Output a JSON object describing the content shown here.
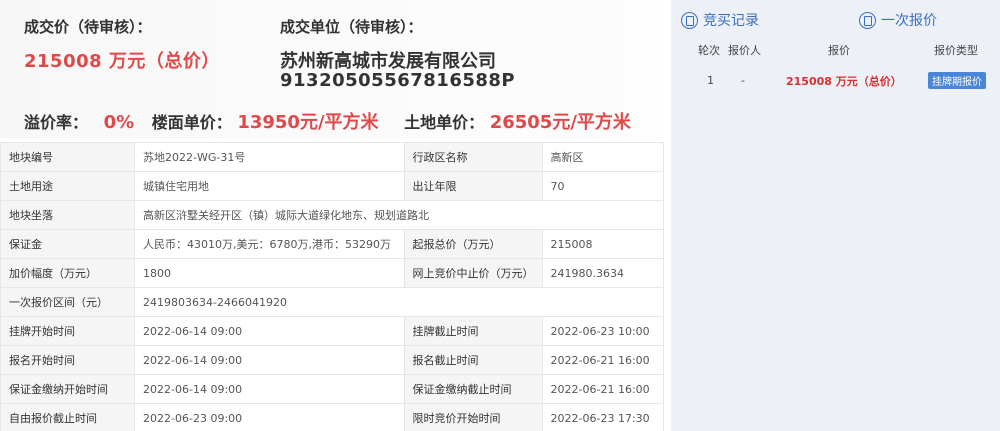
{
  "summary": {
    "deal_price_label": "成交价（待审核）：",
    "deal_price_value": "215008 万元（总价）",
    "deal_unit_label": "成交单位（待审核）：",
    "deal_unit_name": "苏州新高城市发展有限公司",
    "deal_unit_code": "91320505567816588P",
    "premium_label": "溢价率：",
    "premium_value": "0%",
    "floor_price_label": "楼面单价：",
    "floor_price_value": "13950元/平方米",
    "land_price_label": "土地单价：",
    "land_price_value": "26505元/平方米"
  },
  "info_table": {
    "rows": [
      {
        "k1": "地块编号",
        "v1": "苏地2022-WG-31号",
        "k2": "行政区名称",
        "v2": "高新区"
      },
      {
        "k1": "土地用途",
        "v1": "城镇住宅用地",
        "k2": "出让年限",
        "v2": "70"
      },
      {
        "k1": "地块坐落",
        "v1": "高新区浒墅关经开区（镇）城际大道绿化地东、规划道路北"
      },
      {
        "k1": "保证金",
        "v1": "人民币：43010万,美元：6780万,港币：53290万",
        "k2": "起报总价（万元）",
        "v2": "215008"
      },
      {
        "k1": "加价幅度（万元）",
        "v1": "1800",
        "k2": "网上竞价中止价（万元）",
        "v2": "241980.3634"
      },
      {
        "k1": "一次报价区间（元）",
        "v1": "2419803634-2466041920"
      },
      {
        "k1": "挂牌开始时间",
        "v1": "2022-06-14 09:00",
        "k2": "挂牌截止时间",
        "v2": "2022-06-23 10:00"
      },
      {
        "k1": "报名开始时间",
        "v1": "2022-06-14 09:00",
        "k2": "报名截止时间",
        "v2": "2022-06-21 16:00"
      },
      {
        "k1": "保证金缴纳开始时间",
        "v1": "2022-06-14 09:00",
        "k2": "保证金缴纳截止时间",
        "v2": "2022-06-21 16:00"
      },
      {
        "k1": "自由报价截止时间",
        "v1": "2022-06-23 09:00",
        "k2": "限时竞价开始时间",
        "v2": "2022-06-23 17:30"
      }
    ]
  },
  "right_panel": {
    "tab_bid_records": "竞买记录",
    "tab_single_quote": "一次报价",
    "headers": {
      "round": "轮次",
      "bidder": "报价人",
      "price": "报价",
      "type": "报价类型"
    },
    "record": {
      "round": "1",
      "bidder": "-",
      "price": "215008 万元（总价）",
      "type": "挂牌期报价"
    }
  },
  "colors": {
    "accent_red": "#e0484a",
    "link_blue": "#3a6fc4",
    "badge_blue": "#4a86d6",
    "panel_bg": "#edf0f6"
  }
}
